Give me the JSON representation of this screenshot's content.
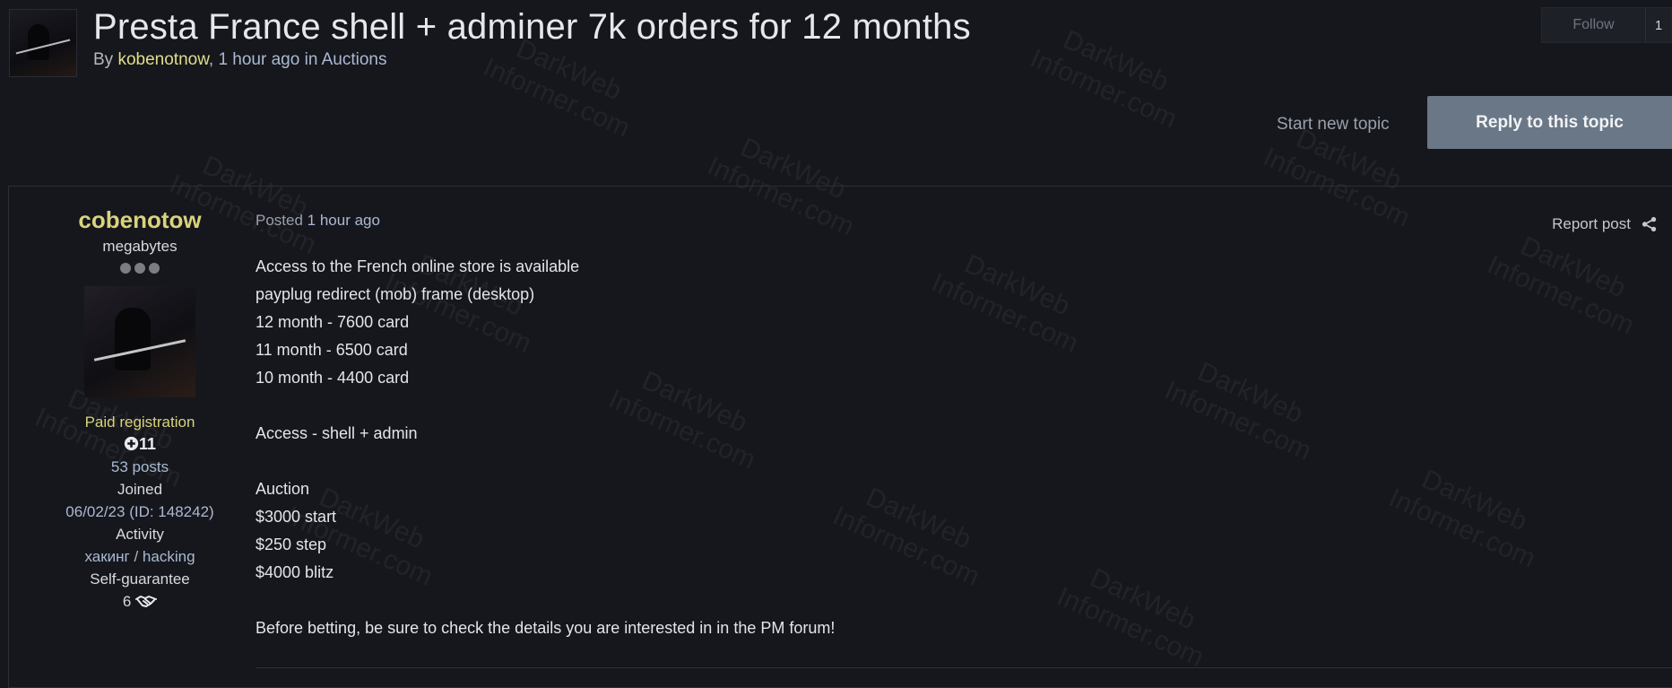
{
  "topic": {
    "title": "Presta France shell + adminer 7k orders for 12 months",
    "by_label": "By",
    "author": "kobenotnow",
    "sep": ",",
    "time": "1 hour ago",
    "in_label": "in",
    "forum": "Auctions"
  },
  "actions": {
    "follow_label": "Follow",
    "follow_count": "1",
    "start_topic": "Start new topic",
    "reply": "Reply to this topic"
  },
  "post": {
    "author": {
      "name": "cobenotow",
      "group": "megabytes",
      "badge": "Paid registration",
      "reputation": "11",
      "posts": "53 posts",
      "joined_label": "Joined",
      "joined_value": "06/02/23 (ID: 148242)",
      "activity_label": "Activity",
      "activity_value": "хакинг / hacking",
      "guarantee_label": "Self-guarantee",
      "guarantee_value": "6"
    },
    "posted_label": "Posted",
    "posted_time": "1 hour ago",
    "report": "Report post",
    "lines": [
      "Access to the French online store is available",
      "payplug redirect (mob) frame (desktop)",
      "12 month - 7600 card",
      "11 month - 6500 card",
      "10 month - 4400 card",
      "",
      "Access - shell + admin",
      "",
      "Auction",
      "$3000 start",
      "$250 step",
      "$4000 blitz",
      "",
      "Before betting, be sure to check the details you are interested in in the PM forum!"
    ]
  },
  "watermark": {
    "line1": "DarkWeb",
    "line2": "Informer.com"
  },
  "colors": {
    "background": "#15171c",
    "accent_yellow": "#d9d37c",
    "link_blue": "#aab9d3",
    "reply_button": "#6a7786"
  },
  "icons": [
    "share-icon",
    "handshake-icon",
    "plus-circle-icon"
  ]
}
